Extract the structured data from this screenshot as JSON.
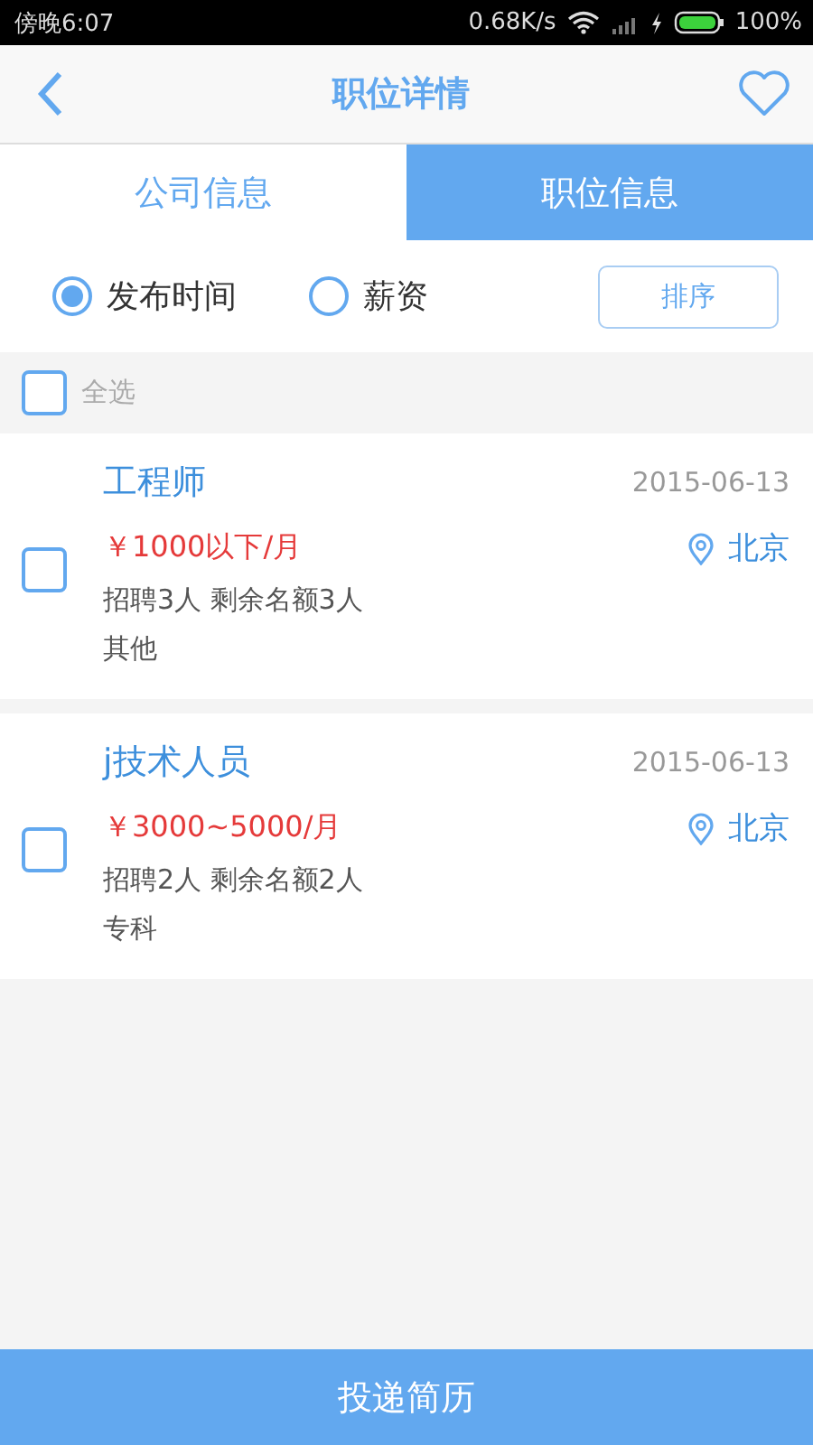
{
  "status_bar": {
    "time": "傍晚6:07",
    "speed": "0.68K/s",
    "battery": "100%"
  },
  "header": {
    "title": "职位详情"
  },
  "tabs": [
    {
      "label": "公司信息",
      "selected": false
    },
    {
      "label": "职位信息",
      "selected": true
    }
  ],
  "sort": {
    "options": [
      {
        "label": "发布时间",
        "selected": true
      },
      {
        "label": "薪资",
        "selected": false
      }
    ],
    "button": "排序"
  },
  "select_all": {
    "label": "全选",
    "checked": false
  },
  "jobs": [
    {
      "title": "工程师",
      "date": "2015-06-13",
      "salary": "￥1000以下/月",
      "location": "北京",
      "quota": "招聘3人 剩余名额3人",
      "education": "其他",
      "checked": false
    },
    {
      "title": "j技术人员",
      "date": "2015-06-13",
      "salary": "￥3000~5000/月",
      "location": "北京",
      "quota": "招聘2人 剩余名额2人",
      "education": "专科",
      "checked": false
    }
  ],
  "submit_button": "投递简历"
}
